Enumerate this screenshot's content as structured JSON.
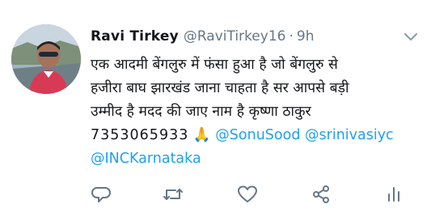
{
  "tweet": {
    "display_name": "Ravi Tirkey",
    "handle": "@RaviTirkey16",
    "separator": "·",
    "time": "9h",
    "text": {
      "line1": "एक आदमी बेंगलुरु में फंसा हुआ है जो बेंगलुरु से",
      "line2": "हजीरा बाघ झारखंड जाना चाहता है सर आपसे बड़ी",
      "line3": "उम्मीद है मदद की जाए नाम है कृष्णा ठाकुर",
      "phone": "7353065933",
      "emoji": "🙏",
      "mention1": "@SonuSood",
      "mention2": "@srinivasiyc",
      "mention3": "@INCKarnataka"
    }
  },
  "icons": {
    "caret": "chevron-down-icon",
    "reply": "reply-icon",
    "retweet": "retweet-icon",
    "like": "heart-icon",
    "share": "share-icon",
    "analytics": "analytics-icon"
  },
  "colors": {
    "text": "#14171a",
    "muted": "#657786",
    "link": "#1da1f2"
  }
}
